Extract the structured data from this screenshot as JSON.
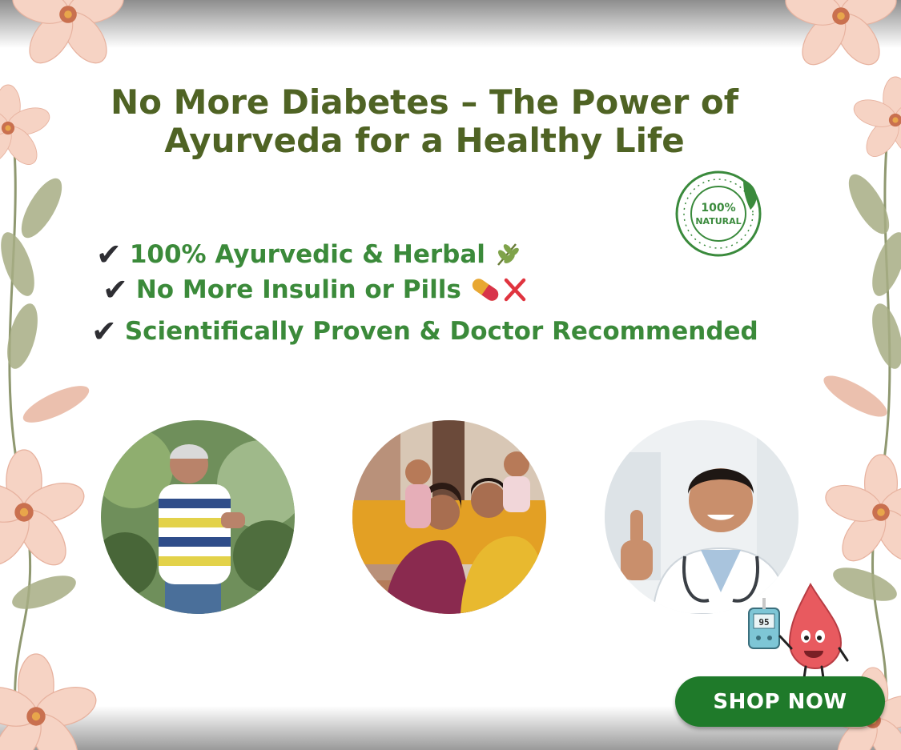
{
  "headline": "No More Diabetes – The Power of Ayurveda for a Healthy Life",
  "seal": {
    "line1": "100%",
    "line2": "NATURAL"
  },
  "features": [
    {
      "text": "100% Ayurvedic & Herbal",
      "icon": "herb-sprig-icon"
    },
    {
      "text": "No More Insulin or Pills",
      "icon": "pill-cross-icon"
    },
    {
      "text": "Scientifically Proven & Doctor Recommended",
      "icon": "none"
    }
  ],
  "check_mark": "✔",
  "photos": [
    {
      "subject": "elderly-man-jogging-photo"
    },
    {
      "subject": "happy-family-photo"
    },
    {
      "subject": "smiling-doctor-thumbs-up-photo"
    }
  ],
  "glucometer_reading": "95",
  "cta": {
    "label": "SHOP NOW"
  },
  "colors": {
    "headline": "#4f6324",
    "feature_text": "#3b8a3a",
    "check": "#2e2e33",
    "button": "#1f7a2a",
    "mascot": "#e85a5f"
  }
}
